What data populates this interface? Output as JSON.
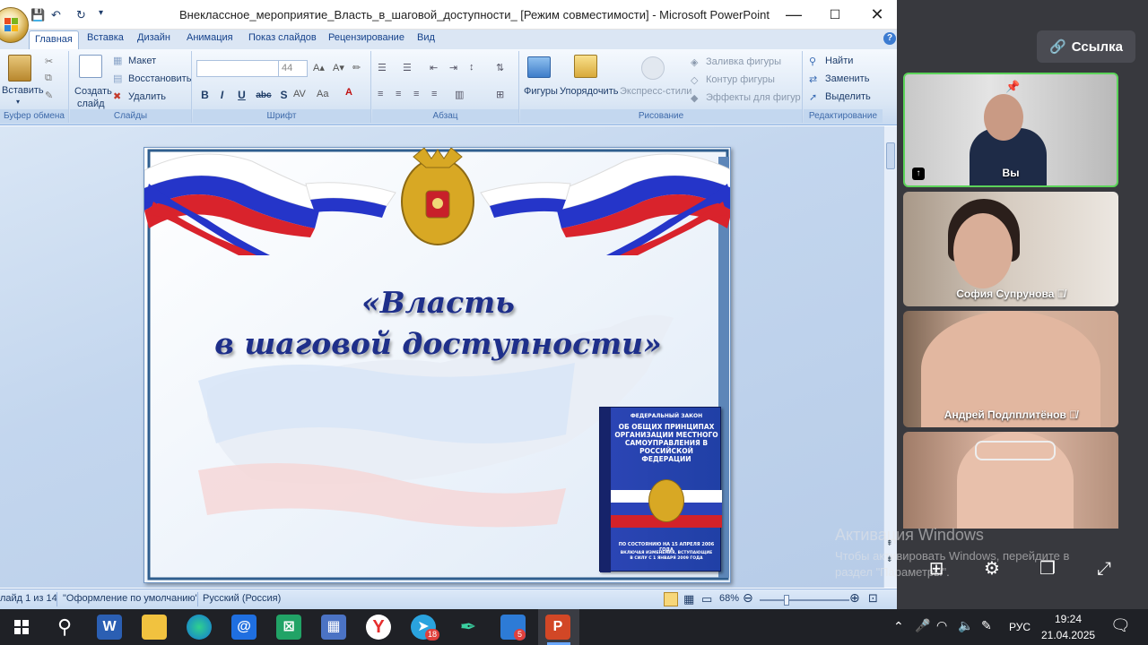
{
  "window": {
    "title": "Внеклассное_мероприятие_Власть_в_шаговой_доступности_ [Режим совместимости] - Microsoft PowerPoint",
    "minimize": "—",
    "maximize": "☐",
    "close": "✕"
  },
  "tabs": [
    "Главная",
    "Вставка",
    "Дизайн",
    "Анимация",
    "Показ слайдов",
    "Рецензирование",
    "Вид"
  ],
  "ribbon": {
    "clipboard": {
      "paste": "Вставить",
      "label": "Буфер обмена"
    },
    "slides": {
      "create": "Создать",
      "create2": "слайд",
      "layout": "Макет",
      "reset": "Восстановить",
      "delete": "Удалить",
      "label": "Слайды"
    },
    "font": {
      "size": "44",
      "bold": "B",
      "italic": "I",
      "underline": "U",
      "strike": "abc",
      "shadow": "S",
      "label": "Шрифт"
    },
    "paragraph": {
      "label": "Абзац"
    },
    "drawing": {
      "shapes": "Фигуры",
      "arrange": "Упорядочить",
      "quick_styles": "Экспресс-стили",
      "fill": "Заливка фигуры",
      "outline": "Контур фигуры",
      "effects": "Эффекты для фигур",
      "label": "Рисование"
    },
    "editing": {
      "find": "Найти",
      "replace": "Заменить",
      "select": "Выделить",
      "label": "Редактирование"
    }
  },
  "slide": {
    "title_line1": "«Власть",
    "title_line2": "в шаговой доступности»",
    "book": {
      "law_type": "ФЕДЕРАЛЬНЫЙ ЗАКОН",
      "title": "ОБ ОБЩИХ ПРИНЦИПАХ ОРГАНИЗАЦИИ МЕСТНОГО САМОУПРАВЛЕНИЯ В РОССИЙСКОЙ ФЕДЕРАЦИИ",
      "date_line": "ПО СОСТОЯНИЮ НА 15 АПРЕЛЯ 2006 ГОДА",
      "note": "ВКЛЮЧАЯ ИЗМЕНЕНИЯ, ВСТУПАЮЩИЕ В СИЛУ С 1 ЯНВАРЯ 2009 ГОДА"
    }
  },
  "statusbar": {
    "slide_counter": "Слайд 1 из 14",
    "theme": "\"Оформление по умолчанию\"",
    "language": "Русский (Россия)",
    "zoom": "68%"
  },
  "meeting": {
    "link_button": "Ссылка",
    "participants": [
      {
        "name": "Вы"
      },
      {
        "name": "София Супрунова"
      },
      {
        "name": "Андрей Подлплитёнов"
      },
      {
        "name": ""
      }
    ]
  },
  "watermark": {
    "line1": "Активация Windows",
    "line2": "Чтобы активировать Windows, перейдите в раздел \"Параметры\"."
  },
  "taskbar": {
    "language": "РУС",
    "time": "19:24",
    "date": "21.04.2025",
    "telegram_badge": "18",
    "app_badge": "5"
  }
}
